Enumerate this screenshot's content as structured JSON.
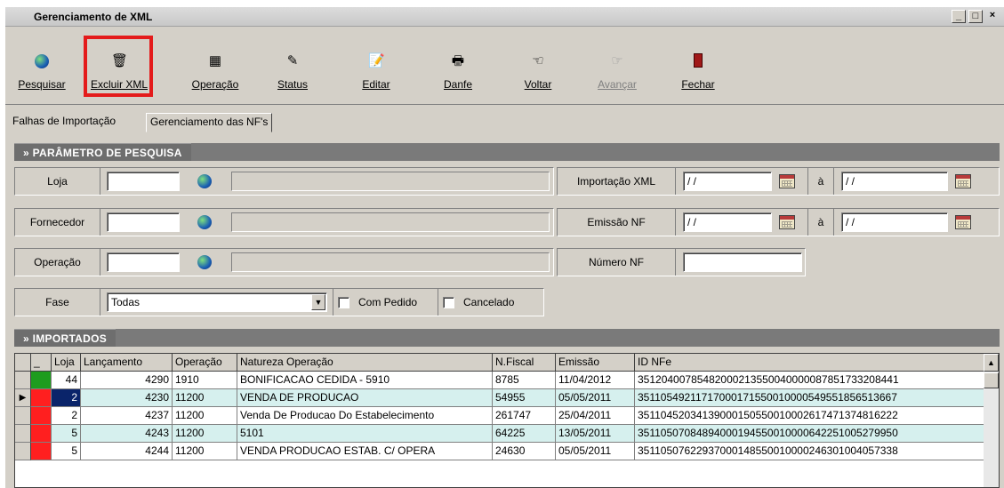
{
  "window": {
    "title": "Gerenciamento de XML"
  },
  "toolbar": {
    "pesquisar": "Pesquisar",
    "excluir_xml": "Excluir XML",
    "operacao": "Operação",
    "status": "Status",
    "editar": "Editar",
    "danfe": "Danfe",
    "voltar": "Voltar",
    "avancar": "Avançar",
    "fechar": "Fechar"
  },
  "tabs": [
    "Falhas de Importação",
    "Gerenciamento das NF's"
  ],
  "search": {
    "header": "» PARÂMETRO DE PESQUISA",
    "loja_label": "Loja",
    "fornecedor_label": "Fornecedor",
    "operacao_label": "Operação",
    "fase_label": "Fase",
    "fase_value": "Todas",
    "com_pedido": "Com Pedido",
    "cancelado": "Cancelado",
    "importacao_label": "Importação XML",
    "emissao_label": "Emissão NF",
    "numero_label": "Número NF",
    "a_label": "à",
    "date_placeholder": " / /"
  },
  "imported": {
    "header": "» IMPORTADOS",
    "columns": [
      "Loja",
      "Lançamento",
      "Operação",
      "Natureza Operação",
      "N.Fiscal",
      "Emissão",
      "ID NFe"
    ],
    "rows": [
      {
        "status": "green",
        "loja": "44",
        "lancamento": "4290",
        "operacao": "1910",
        "natureza": "BONIFICACAO CEDIDA - 5910",
        "nfiscal": "8785",
        "emissao": "11/04/2012",
        "idnfe": "35120400785482000213550040000087851733208441"
      },
      {
        "status": "red",
        "loja": "2",
        "lancamento": "4230",
        "operacao": "11200",
        "natureza": "VENDA DE PRODUCAO",
        "nfiscal": "54955",
        "emissao": "05/05/2011",
        "idnfe": "35110549211717000171550010000549551856513667"
      },
      {
        "status": "red",
        "loja": "2",
        "lancamento": "4237",
        "operacao": "11200",
        "natureza": "Venda De Producao Do Estabelecimento",
        "nfiscal": "261747",
        "emissao": "25/04/2011",
        "idnfe": "35110452034139000150550010002617471374816222"
      },
      {
        "status": "red",
        "loja": "5",
        "lancamento": "4243",
        "operacao": "11200",
        "natureza": "5101",
        "nfiscal": "64225",
        "emissao": "13/05/2011",
        "idnfe": "35110507084894000194550010000642251005279950"
      },
      {
        "status": "red",
        "loja": "5",
        "lancamento": "4244",
        "operacao": "11200",
        "natureza": "VENDA PRODUCAO ESTAB. C/ OPERA",
        "nfiscal": "24630",
        "emissao": "05/05/2011",
        "idnfe": "35110507622937000148550010000246301004057338"
      }
    ]
  },
  "colors": {
    "status_green": "#1e9c1e",
    "status_red": "#ff1f1f",
    "highlight": "#e41b1b",
    "alt_row": "#d6f0ee"
  }
}
